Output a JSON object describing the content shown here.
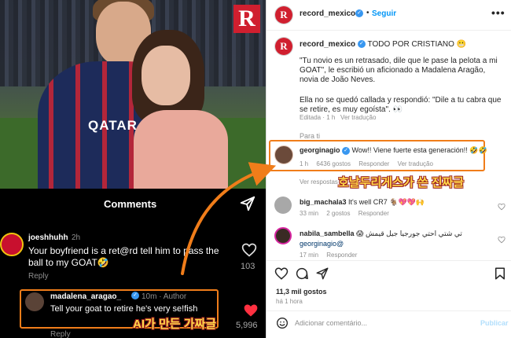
{
  "left_post": {
    "photo_logo": "R",
    "shirt_text": "QATAR",
    "comments_title": "Comments",
    "comment1": {
      "user": "joeshhuhh",
      "time": "2h",
      "text": "Your boyfriend is a ret@rd tell him to pass the ball to my GOAT🤣",
      "reply": "Reply",
      "likes": "103"
    },
    "comment2": {
      "user": "madalena_aragao_",
      "meta": "10m · Author",
      "text": "Tell your goat to retire he's very se!fish",
      "reply": "Reply",
      "likes": "5,996"
    },
    "ai_caption": "AI가 만든 가짜글"
  },
  "right_post": {
    "header": {
      "user": "record_mexico",
      "dot": "•",
      "follow": "Seguir",
      "more": "•••",
      "avatar_letter": "R"
    },
    "caption": {
      "user": "record_mexico",
      "headline": "TODO POR CRISTIANO 😬",
      "quote": "\"Tu novio es un retrasado, dile que le pase la pelota a mi GOAT\", le escribió un aficionado a Madalena Aragão, novia de João Neves.",
      "reply": "Ella no se quedó callada y respondió: \"Dile a tu cabra que se retire, es muy egoísta\". 👀",
      "meta_edited": "Editada · 1 h",
      "meta_translate": "Ver tradução"
    },
    "para_ti": "Para ti",
    "highlight_comment": {
      "user": "georginagio",
      "text": "Wow!! Viene fuerte esta generación!! 🤣🤣",
      "time": "1 h",
      "likes": "6436 gostos",
      "reply": "Responder",
      "translate": "Ver tradução"
    },
    "ko_caption": "호날두리게스가 쓴 진짜글",
    "ver_respostas": "Ver respostas",
    "comment_bm": {
      "user": "big_machala3",
      "text": "It's well CR7 🐐💖💖🙌",
      "time": "33 min",
      "likes": "2 gostos",
      "reply": "Responder"
    },
    "comment_ns": {
      "user": "nabila_sambella",
      "text": "😱 تي شتي احتي جورجيا جيل قيمش",
      "mention": "georginagio@",
      "time": "17 min",
      "reply": "Responder"
    },
    "likes": "11,3 mil gostos",
    "ago": "há 1 hora",
    "comment_placeholder": "Adicionar comentário...",
    "publish": "Publicar"
  },
  "colors": {
    "highlight_border": "#f07d1a",
    "caption_yellow": "#ffd84a",
    "verified_blue": "#3897f0",
    "like_red": "#ff3040"
  }
}
